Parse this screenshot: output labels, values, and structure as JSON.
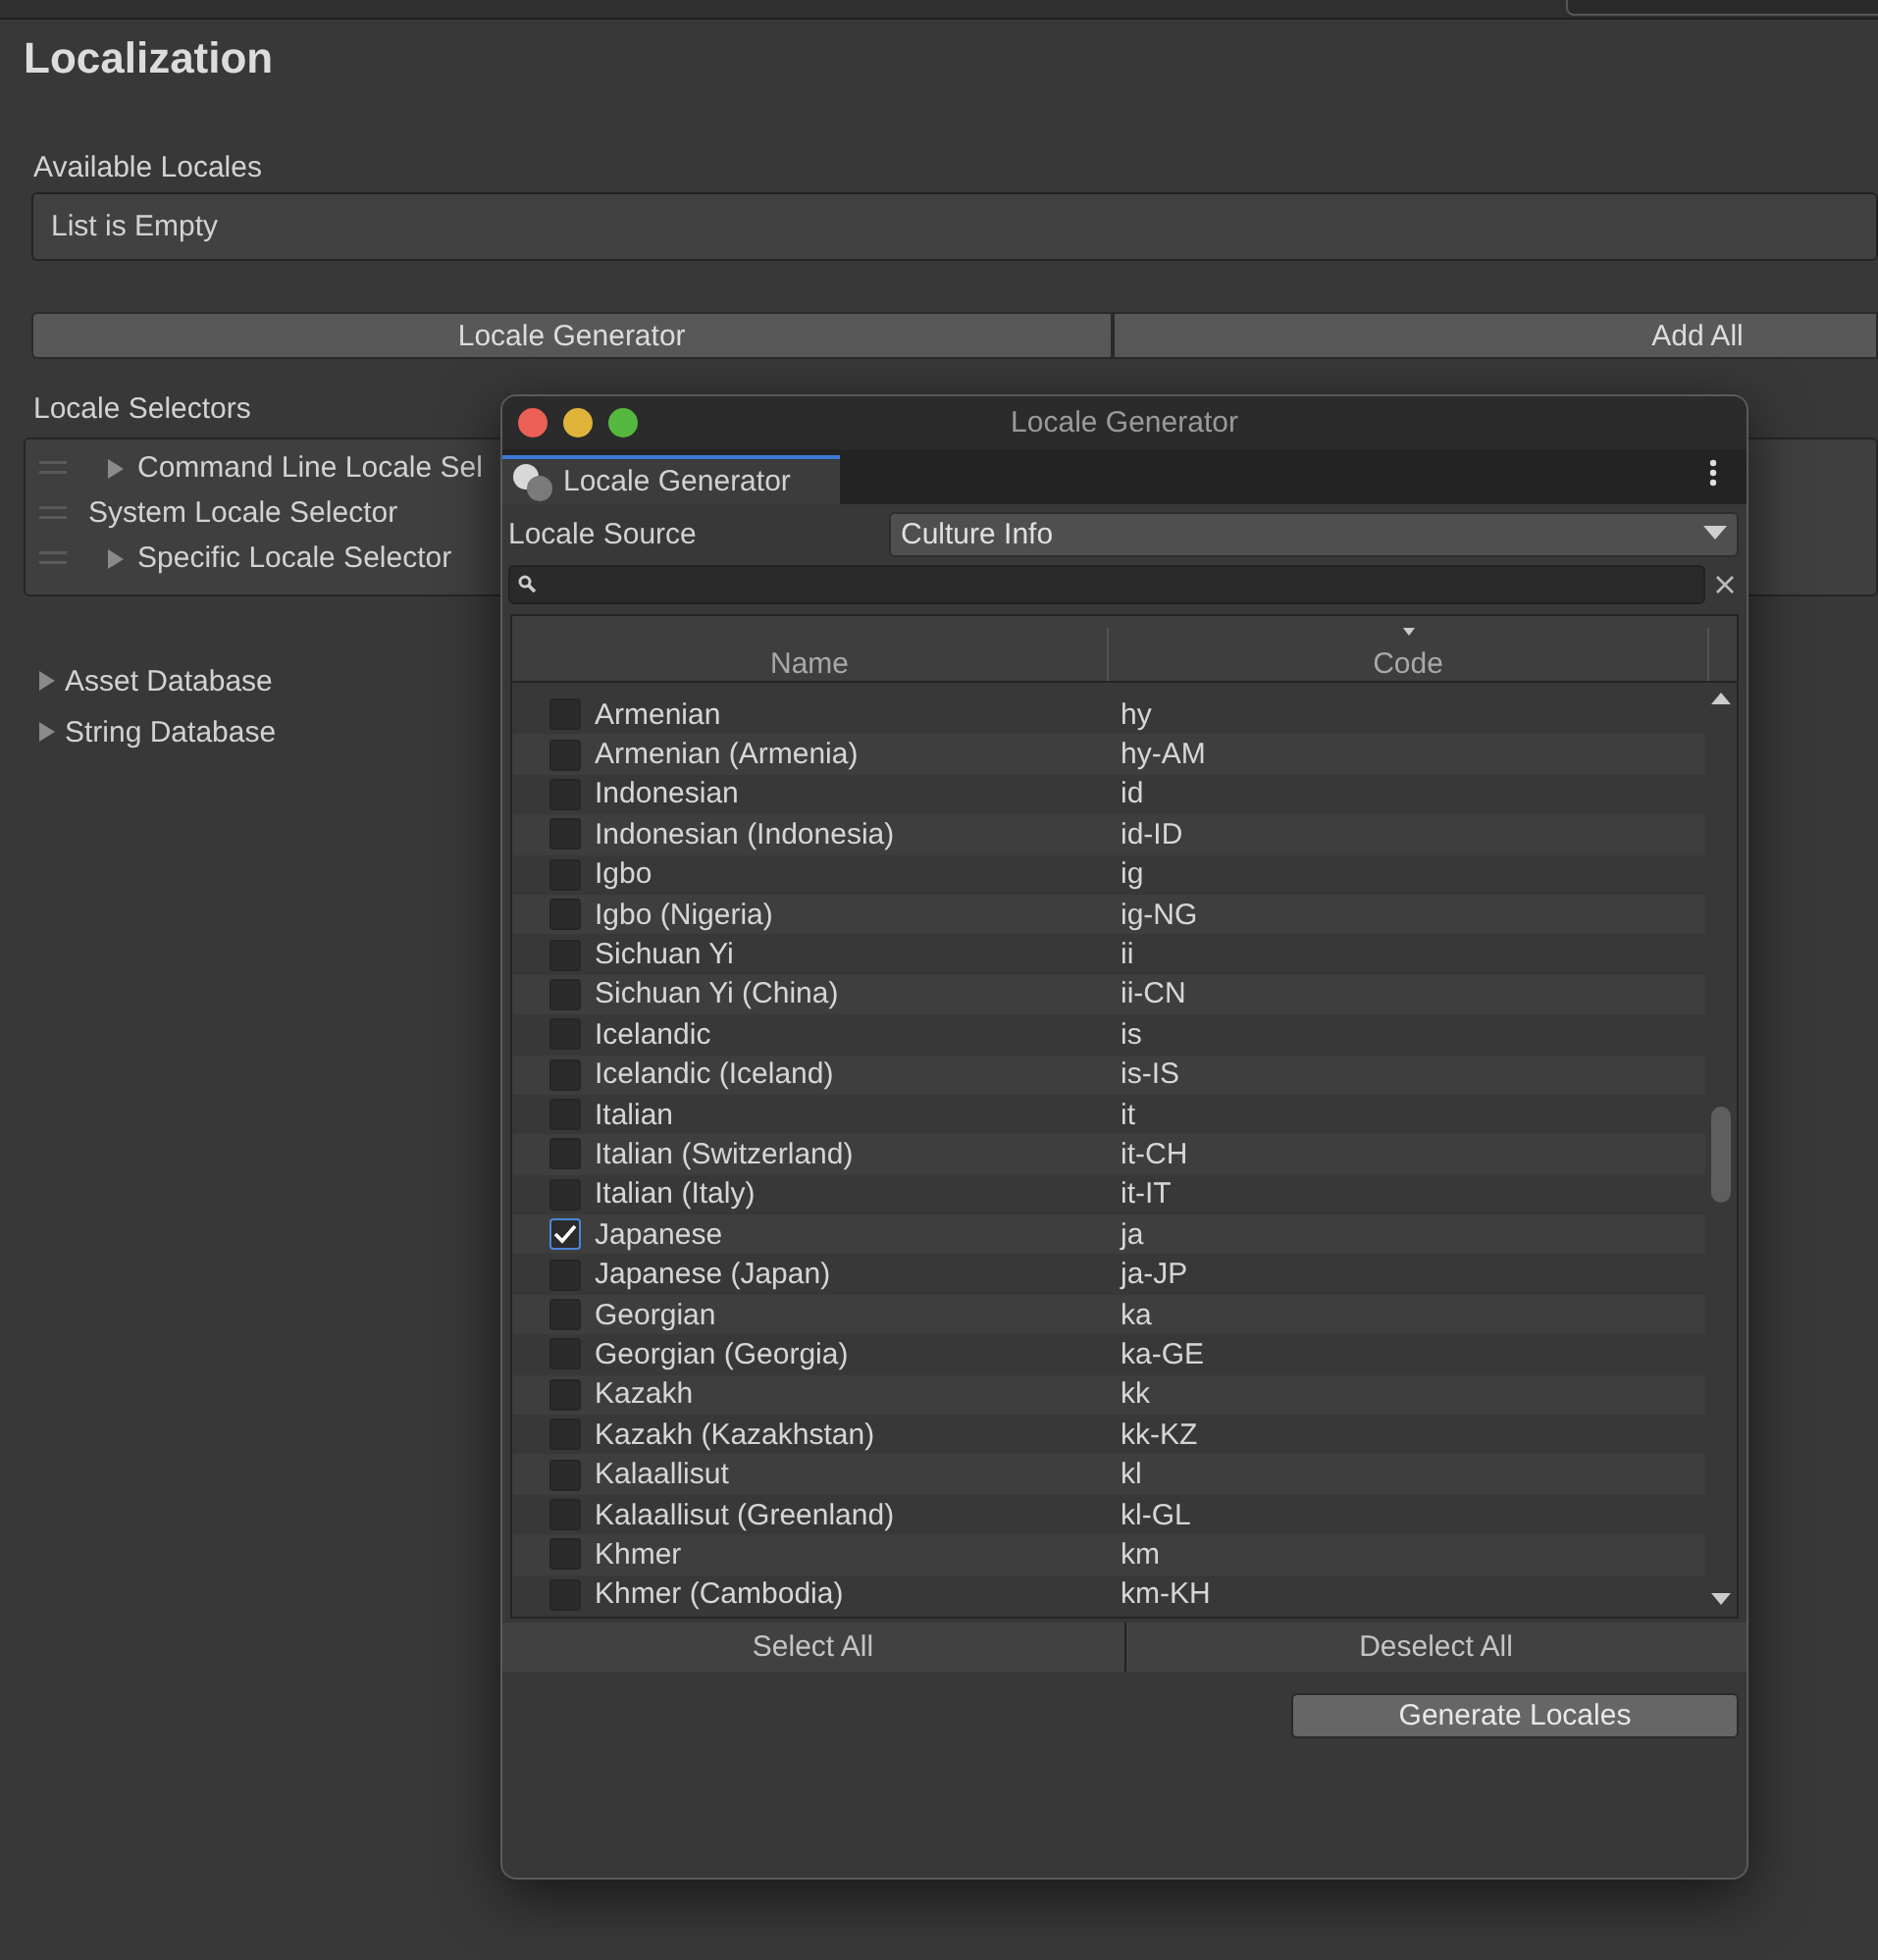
{
  "inspector": {
    "title": "Localization",
    "available_locales": {
      "label": "Available Locales",
      "empty_text": "List is Empty"
    },
    "buttons": [
      "Locale Generator",
      "Add All"
    ],
    "locale_selectors": {
      "label": "Locale Selectors",
      "items": [
        {
          "label": "Command Line Locale Sel",
          "expandable": true
        },
        {
          "label": "System Locale Selector",
          "expandable": false
        },
        {
          "label": "Specific Locale Selector",
          "expandable": true
        }
      ]
    },
    "foldouts": [
      {
        "label": "Asset Database",
        "expanded": false
      },
      {
        "label": "String Database",
        "expanded": false
      }
    ]
  },
  "dialog": {
    "title": "Locale Generator",
    "tab": {
      "label": "Locale Generator",
      "selected": true
    },
    "locale_source": {
      "label": "Locale Source",
      "value": "Culture Info"
    },
    "columns": [
      {
        "label": "Name",
        "sorted": false
      },
      {
        "label": "Code",
        "sorted": true
      }
    ],
    "rows": [
      {
        "name": "Armenian",
        "code": "hy",
        "checked": false
      },
      {
        "name": "Armenian (Armenia)",
        "code": "hy-AM",
        "checked": false
      },
      {
        "name": "Indonesian",
        "code": "id",
        "checked": false
      },
      {
        "name": "Indonesian (Indonesia)",
        "code": "id-ID",
        "checked": false
      },
      {
        "name": "Igbo",
        "code": "ig",
        "checked": false
      },
      {
        "name": "Igbo (Nigeria)",
        "code": "ig-NG",
        "checked": false
      },
      {
        "name": "Sichuan Yi",
        "code": "ii",
        "checked": false
      },
      {
        "name": "Sichuan Yi (China)",
        "code": "ii-CN",
        "checked": false
      },
      {
        "name": "Icelandic",
        "code": "is",
        "checked": false
      },
      {
        "name": "Icelandic (Iceland)",
        "code": "is-IS",
        "checked": false
      },
      {
        "name": "Italian",
        "code": "it",
        "checked": false
      },
      {
        "name": "Italian (Switzerland)",
        "code": "it-CH",
        "checked": false
      },
      {
        "name": "Italian (Italy)",
        "code": "it-IT",
        "checked": false
      },
      {
        "name": "Japanese",
        "code": "ja",
        "checked": true
      },
      {
        "name": "Japanese (Japan)",
        "code": "ja-JP",
        "checked": false
      },
      {
        "name": "Georgian",
        "code": "ka",
        "checked": false
      },
      {
        "name": "Georgian (Georgia)",
        "code": "ka-GE",
        "checked": false
      },
      {
        "name": "Kazakh",
        "code": "kk",
        "checked": false
      },
      {
        "name": "Kazakh (Kazakhstan)",
        "code": "kk-KZ",
        "checked": false
      },
      {
        "name": "Kalaallisut",
        "code": "kl",
        "checked": false
      },
      {
        "name": "Kalaallisut (Greenland)",
        "code": "kl-GL",
        "checked": false
      },
      {
        "name": "Khmer",
        "code": "km",
        "checked": false
      },
      {
        "name": "Khmer (Cambodia)",
        "code": "km-KH",
        "checked": false
      }
    ],
    "buttons": [
      "Select All",
      "Deselect All"
    ],
    "generate_button": "Generate Locales"
  }
}
